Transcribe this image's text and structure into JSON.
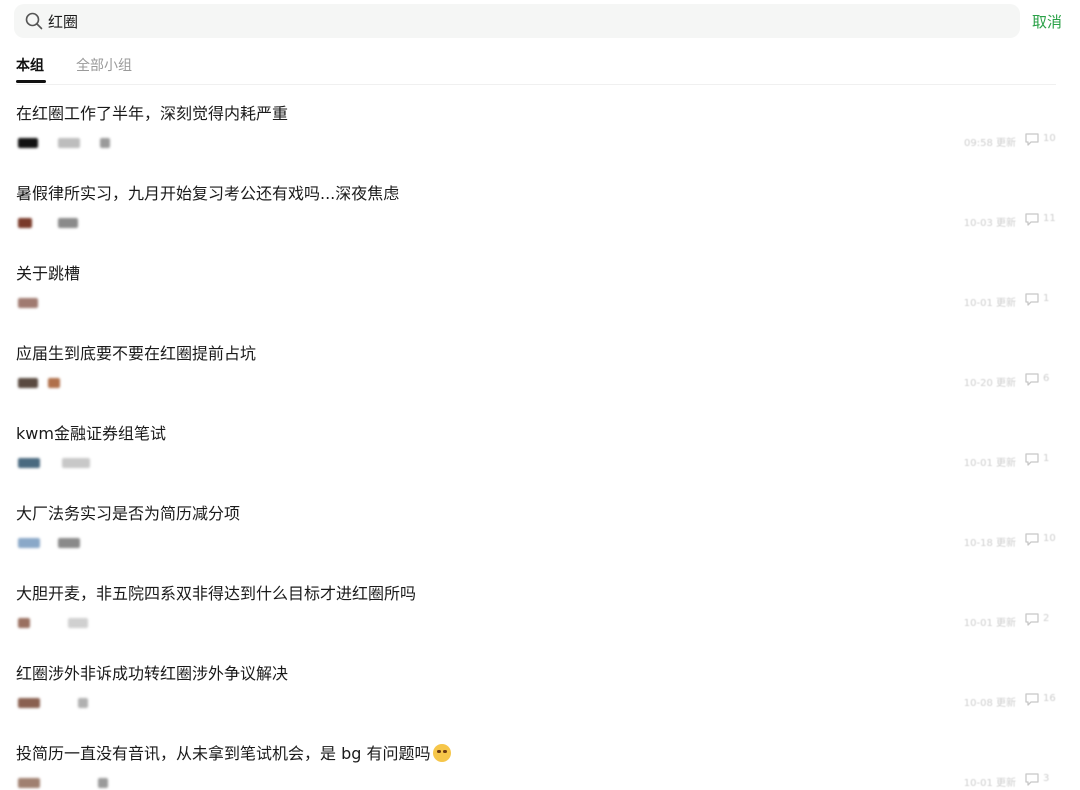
{
  "search": {
    "value": "红圈",
    "icon": "search-icon",
    "cancel_label": "取消"
  },
  "tabs": [
    {
      "label": "本组",
      "active": true
    },
    {
      "label": "全部小组",
      "active": false
    }
  ],
  "posts": [
    {
      "title": "在红圈工作了半年，深刻觉得内耗严重",
      "time": "09:58 更新",
      "comments": "10"
    },
    {
      "title": "暑假律所实习，九月开始复习考公还有戏吗...深夜焦虑",
      "time": "10-03 更新",
      "comments": "11"
    },
    {
      "title": "关于跳槽",
      "time": "10-01 更新",
      "comments": "1"
    },
    {
      "title": "应届生到底要不要在红圈提前占坑",
      "time": "10-20 更新",
      "comments": "6"
    },
    {
      "title": "kwm金融证券组笔试",
      "time": "10-01 更新",
      "comments": "1"
    },
    {
      "title": "大厂法务实习是否为简历减分项",
      "time": "10-18 更新",
      "comments": "10"
    },
    {
      "title": "大胆开麦，非五院四系双非得达到什么目标才进红圈所吗",
      "time": "10-01 更新",
      "comments": "2"
    },
    {
      "title": "红圈涉外非诉成功转红圈涉外争议解决",
      "time": "10-08 更新",
      "comments": "16"
    },
    {
      "title": "投简历一直没有音讯，从未拿到笔试机会，是 bg 有问题吗",
      "time": "10-01 更新",
      "comments": "3"
    }
  ],
  "colors": {
    "accent": "#2aa147",
    "text": "#1a1a1a",
    "muted": "#9a9a9a"
  }
}
